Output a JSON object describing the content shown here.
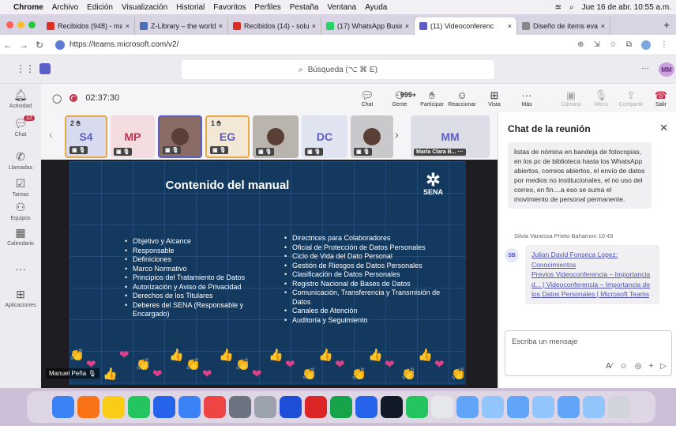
{
  "menubar": {
    "apple": "",
    "items": [
      "Chrome",
      "Archivo",
      "Edición",
      "Visualización",
      "Historial",
      "Favoritos",
      "Perfiles",
      "Pestaña",
      "Ventana",
      "Ayuda"
    ],
    "datetime": "Jue 16 de abr.  10:55 a.m."
  },
  "tabs": [
    {
      "label": "Recibidos (948) - mac",
      "icon": "gmail-icon",
      "color": "#d93025"
    },
    {
      "label": "Z-Library – the world's",
      "icon": "zlibrary-icon",
      "color": "#4a6fb5"
    },
    {
      "label": "Recibidos (14) - soluci",
      "icon": "gmail-icon",
      "color": "#d93025"
    },
    {
      "label": "(17) WhatsApp Busines",
      "icon": "whatsapp-icon",
      "color": "#25d366"
    },
    {
      "label": "(11) Videoconferenc",
      "icon": "teams-icon",
      "color": "#5b5fc7",
      "active": true
    },
    {
      "label": "Diseño de ítems evalu",
      "icon": "doc-icon",
      "color": "#888"
    }
  ],
  "url": "https://teams.microsoft.com/v2/",
  "teams": {
    "search_placeholder": "Búsqueda (⌥ ⌘ E)",
    "more": "···",
    "avatar": "MM"
  },
  "rail": [
    {
      "label": "Actividad",
      "icon": "bell-icon"
    },
    {
      "label": "Chat",
      "icon": "chat-icon",
      "badge": "12"
    },
    {
      "label": "Llamadas",
      "icon": "phone-icon"
    },
    {
      "label": "Tareas",
      "icon": "tasks-icon"
    },
    {
      "label": "Equipos",
      "icon": "teams-people-icon"
    },
    {
      "label": "Calendario",
      "icon": "calendar-icon"
    },
    {
      "label": "···",
      "icon": "more-icon"
    },
    {
      "label": "Aplicaciones",
      "icon": "apps-icon"
    }
  ],
  "call": {
    "timer": "02:37:30",
    "controls": [
      {
        "label": "Chat",
        "icon": "chat-icon"
      },
      {
        "label": "Gente",
        "icon": "people-icon",
        "count": "999+"
      },
      {
        "label": "Participar",
        "icon": "hand-icon"
      },
      {
        "label": "Reaccionar",
        "icon": "smile-icon"
      },
      {
        "label": "Vista",
        "icon": "view-icon"
      },
      {
        "label": "Más",
        "icon": "more-icon"
      },
      {
        "label": "Cámara",
        "icon": "camera-off-icon",
        "disabled": true
      },
      {
        "label": "Micro",
        "icon": "mic-off-icon",
        "disabled": true
      },
      {
        "label": "Compartir",
        "icon": "share-icon",
        "disabled": true
      },
      {
        "label": "Salir",
        "icon": "hangup-icon"
      }
    ],
    "participants": [
      {
        "initials": "S4",
        "badge": "2",
        "selected": true
      },
      {
        "initials": "MP"
      },
      {
        "initials": "",
        "photo": true,
        "selected": true
      },
      {
        "initials": "EG",
        "badge": "1",
        "selected": true
      },
      {
        "initials": "",
        "photo": true
      },
      {
        "initials": "DC"
      },
      {
        "initials": "",
        "photo": true
      },
      {
        "initials": "MM",
        "name": "María Clara B..."
      }
    ],
    "presenter": "Manuel Peña"
  },
  "slide": {
    "title": "Contenido del manual",
    "logo": "SENA",
    "col1": [
      "Objetivo y Alcance",
      "Responsable",
      "Definiciones",
      "Marco Normativo",
      "Principios del Tratamiento de Datos",
      "Autorización y Aviso de Privacidad",
      "Derechos de los Titulares",
      "Deberes del SENA (Responsable y Encargado)"
    ],
    "col2": [
      "Directrices para Colaboradores",
      "Oficial de Protección de Datos Personales",
      "Ciclo de Vida del Dato Personal",
      "Gestión de Riesgos de Datos Personales",
      "Clasificación de Datos Personales",
      "Registro Nacional de Bases de Datos",
      "Comunicación, Transferencia y Transmisión de Datos",
      "Canales de Atención",
      "Auditoría y Seguimiento"
    ]
  },
  "chat": {
    "title": "Chat de la reunión",
    "msg1": "listas de nómina en bandeja de fotocopias, en los pc de biblioteca hasta los WhatsApp abiertos, correos abiertos, el envío de datos por medios no institucionales, el no uso del correo, en fin....a eso se suma el movimiento de personal permanente.",
    "meta": "Silvia Vanessa Prieto Bahamon  10:43",
    "sender_initials": "SB",
    "mention": "Julian David Fonseca Lopez:",
    "link_word": "Conocimientos",
    "link": "Previos Videoconferencia – Importancia d... | Videoconferencia – Importancia de los Datos Personales | Microsoft Teams",
    "composer_placeholder": "Escriba un mensaje"
  },
  "dock": {
    "colors": [
      "#3b82f6",
      "#f97316",
      "#facc15",
      "#22c55e",
      "#2563eb",
      "#3b82f6",
      "#ef4444",
      "#6b7280",
      "#9ca3af",
      "#1d4ed8",
      "#dc2626",
      "#16a34a",
      "#2563eb",
      "#111827",
      "#22c55e",
      "#e5e7eb",
      "#60a5fa",
      "#93c5fd",
      "#60a5fa",
      "#93c5fd",
      "#60a5fa",
      "#93c5fd",
      "#d1d5db"
    ]
  }
}
